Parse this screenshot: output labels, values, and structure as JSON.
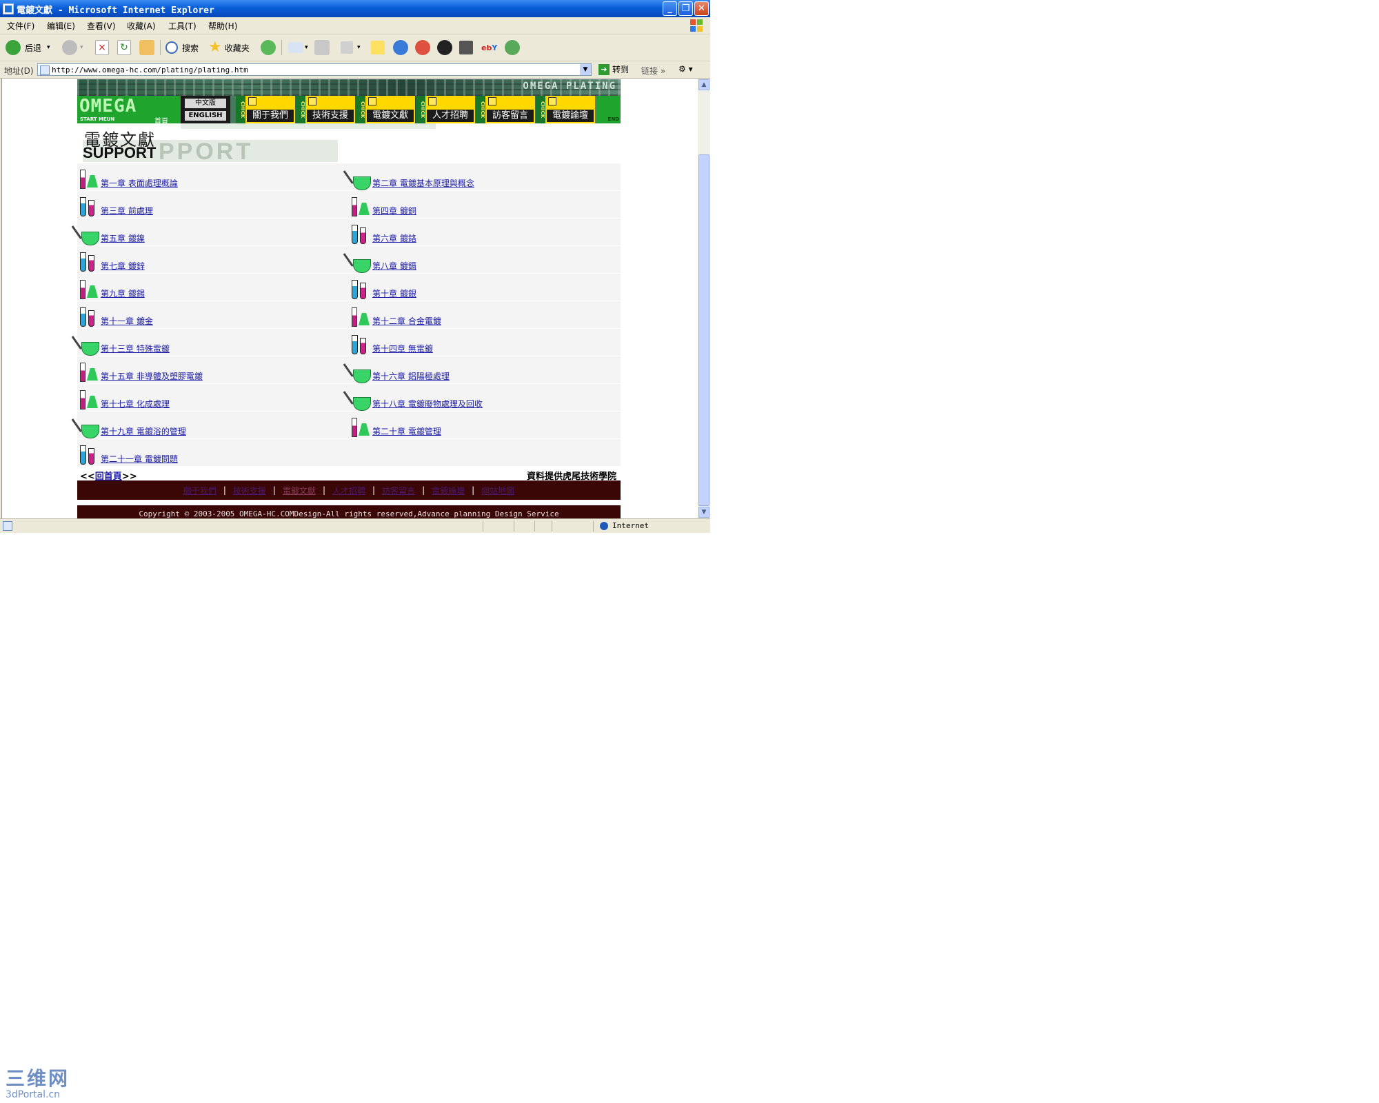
{
  "window": {
    "title": "電鍍文獻 - Microsoft Internet Explorer",
    "minimize": "_",
    "maximize": "❐",
    "close": "✕"
  },
  "menu": [
    "文件(F)",
    "编辑(E)",
    "查看(V)",
    "收藏(A)",
    "工具(T)",
    "帮助(H)"
  ],
  "toolbar": {
    "back_label": "后退",
    "search_label": "搜索",
    "favorites_label": "收藏夹"
  },
  "address": {
    "label": "地址(D)",
    "url": "http://www.omega-hc.com/plating/plating.htm",
    "go_label": "转到",
    "links_label": "链接"
  },
  "banner": {
    "brand": "OMEGA PLATING",
    "logo": "OMEGA",
    "start_menu": "START MEUN",
    "home": "首頁",
    "lang_cn": "中文版",
    "lang_en": "ENGLISH",
    "tab_strip": "CHICK",
    "end_text": "END",
    "tabs": [
      "關于我們",
      "技術支援",
      "電鍍文獻",
      "人才招聘",
      "訪客留言",
      "電鍍論壇"
    ]
  },
  "section": {
    "title_cn": "電鍍文獻",
    "title_en": "SUPPORT",
    "title_ghost": "PPORT"
  },
  "chapters": [
    {
      "label": "第一章  表面處理概論",
      "icon": "flask-icon"
    },
    {
      "label": "第二章  電鍍基本原理與概念",
      "icon": "beaker-icon"
    },
    {
      "label": "第三章  前處理",
      "icon": "test-tube-icon"
    },
    {
      "label": "第四章  鍍銅",
      "icon": "flask-icon"
    },
    {
      "label": "第五章  鍍鎳",
      "icon": "beaker-icon"
    },
    {
      "label": "第六章  鍍鉻",
      "icon": "test-tube-icon"
    },
    {
      "label": "第七章  鍍鋅",
      "icon": "test-tube-icon"
    },
    {
      "label": "第八章  鍍鎘",
      "icon": "beaker-icon"
    },
    {
      "label": "第九章  鍍錫",
      "icon": "flask-icon"
    },
    {
      "label": "第十章  鍍銀",
      "icon": "test-tube-icon"
    },
    {
      "label": "第十一章  鍍金",
      "icon": "test-tube-icon"
    },
    {
      "label": "第十二章  合金電鍍",
      "icon": "flask-icon"
    },
    {
      "label": "第十三章  特殊電鍍",
      "icon": "beaker-icon"
    },
    {
      "label": "第十四章  無電鍍",
      "icon": "test-tube-icon"
    },
    {
      "label": "第十五章  非導體及塑膠電鍍",
      "icon": "flask-icon"
    },
    {
      "label": "第十六章  鋁陽極處理",
      "icon": "beaker-icon"
    },
    {
      "label": "第十七章  化成處理",
      "icon": "flask-icon"
    },
    {
      "label": "第十八章  電鍍廢物處理及回收",
      "icon": "beaker-icon"
    },
    {
      "label": "第十九章  電鍍浴的管理",
      "icon": "beaker-icon"
    },
    {
      "label": "第二十章  電鍍管理",
      "icon": "flask-icon"
    },
    {
      "label": "第二十一章  電鍍問題",
      "icon": "test-tube-icon"
    }
  ],
  "back": {
    "prefix": "<<",
    "link": "回首頁",
    "suffix": ">>"
  },
  "credit": "資料提供虎尾技術學院",
  "footer_nav": [
    "關于我們",
    "技術支援",
    "電鍍文獻",
    "人才招聘",
    "訪客留言",
    "電鍍論壇",
    "網站地圖"
  ],
  "footer_sep": "|",
  "copyright": "Copyright © 2003-2005 OMEGA-HC.COMDesign-All rights reserved,Advance planning Design Service",
  "status": {
    "zone": "Internet"
  },
  "watermark": {
    "top": "三维网",
    "bottom": "3dPortal.cn"
  },
  "colors": {
    "link": "#1a1aa6",
    "title_bar": "#0a5fd8",
    "footer_bg": "#3a0606",
    "nav_tab": "#ffd800",
    "logo_bg": "#1fa52d"
  }
}
